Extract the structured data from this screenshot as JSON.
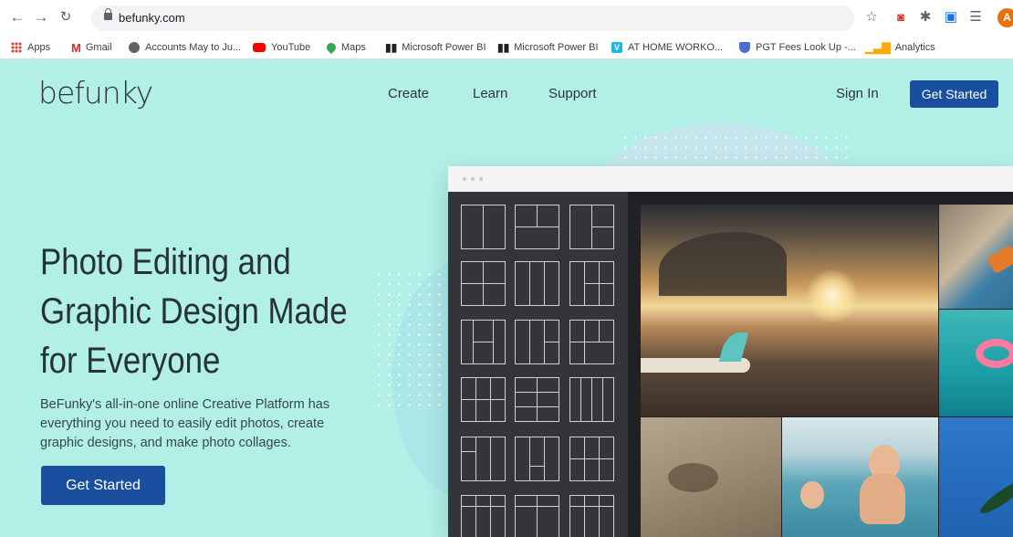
{
  "browser": {
    "url": "befunky.com",
    "avatar_initial": "A",
    "bookmarks": [
      {
        "label": "Apps",
        "icon": "apps-grid-icon",
        "color": "#ea4335"
      },
      {
        "label": "Gmail",
        "icon": "gmail-icon",
        "color": "#d93025"
      },
      {
        "label": "Accounts May to Ju...",
        "icon": "globe-icon",
        "color": "#5f6368"
      },
      {
        "label": "YouTube",
        "icon": "youtube-icon",
        "color": "#ff0000"
      },
      {
        "label": "Maps",
        "icon": "maps-pin-icon",
        "color": "#34a853"
      },
      {
        "label": "Microsoft Power BI",
        "icon": "power-bi-icon",
        "color": "#202124"
      },
      {
        "label": "Microsoft Power BI",
        "icon": "power-bi-icon",
        "color": "#202124"
      },
      {
        "label": "AT HOME WORKO...",
        "icon": "vimeo-icon",
        "color": "#1ab7ea"
      },
      {
        "label": "PGT Fees Look Up -...",
        "icon": "shield-icon",
        "color": "#4a6fd4"
      },
      {
        "label": "Analytics",
        "icon": "analytics-icon",
        "color": "#f9ab00"
      }
    ]
  },
  "site": {
    "logo": "befunky",
    "nav": [
      "Create",
      "Learn",
      "Support"
    ],
    "signin": "Sign In",
    "cta_top": "Get Started",
    "hero_title": "Photo Editing and Graphic Design Made for Everyone",
    "hero_sub": "BeFunky's all-in-one online Creative Platform has everything you need to easily edit photos, create graphic designs, and make photo collages.",
    "cta_hero": "Get Started"
  },
  "colors": {
    "page_bg": "#b2efe6",
    "primary": "#1a4fa0",
    "mock_sidebar": "#33353b"
  }
}
